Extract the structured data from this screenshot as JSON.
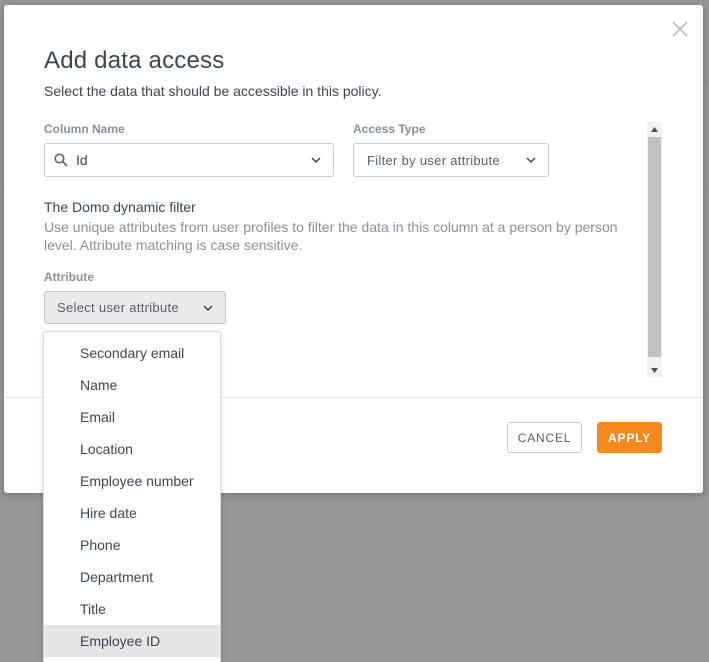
{
  "dialog": {
    "title": "Add data access",
    "subtitle": "Select the data that should be accessible in this policy."
  },
  "column_name": {
    "label": "Column Name",
    "value": "Id"
  },
  "access_type": {
    "label": "Access Type",
    "value": "Filter by user attribute"
  },
  "filter_info": {
    "title": "The Domo dynamic filter",
    "description": "Use unique attributes from user profiles to filter the data in this column at a person by person level. Attribute matching is case sensitive."
  },
  "attribute": {
    "label": "Attribute",
    "placeholder": "Select user attribute"
  },
  "dropdown": {
    "items": [
      "Secondary email",
      "Name",
      "Email",
      "Location",
      "Employee number",
      "Hire date",
      "Phone",
      "Department",
      "Title",
      "Employee ID"
    ],
    "highlighted": "Employee ID"
  },
  "actions": {
    "cancel_label": "CANCEL",
    "apply_label": "APPLY"
  },
  "colors": {
    "accent": "#f8891e",
    "overlay": "#979797"
  }
}
